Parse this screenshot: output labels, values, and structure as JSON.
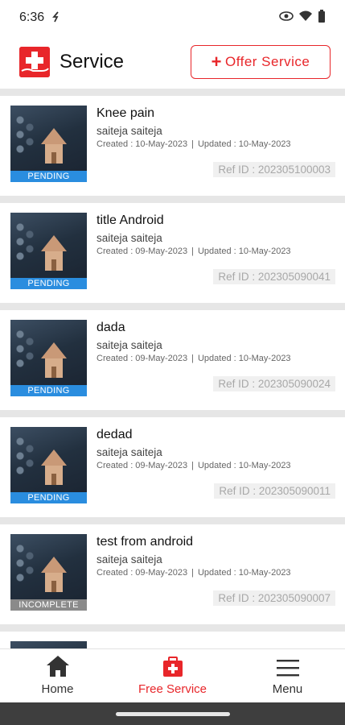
{
  "status_bar": {
    "time": "6:36"
  },
  "header": {
    "title": "Service",
    "offer_button": "Offer Service",
    "brand_color": "#e8262a"
  },
  "services": [
    {
      "title": "Knee pain",
      "user": "saiteja saiteja",
      "created": "Created : 10-May-2023",
      "updated": "Updated : 10-May-2023",
      "ref": "Ref ID : 202305100003",
      "status": "PENDING"
    },
    {
      "title": "title Android",
      "user": "saiteja saiteja",
      "created": "Created : 09-May-2023",
      "updated": "Updated : 10-May-2023",
      "ref": "Ref ID : 202305090041",
      "status": "PENDING"
    },
    {
      "title": "dada",
      "user": "saiteja saiteja",
      "created": "Created : 09-May-2023",
      "updated": "Updated : 10-May-2023",
      "ref": "Ref ID : 202305090024",
      "status": "PENDING"
    },
    {
      "title": "dedad",
      "user": "saiteja saiteja",
      "created": "Created : 09-May-2023",
      "updated": "Updated : 10-May-2023",
      "ref": "Ref ID : 202305090011",
      "status": "PENDING"
    },
    {
      "title": "test from android",
      "user": "saiteja saiteja",
      "created": "Created : 09-May-2023",
      "updated": "Updated : 10-May-2023",
      "ref": "Ref ID : 202305090007",
      "status": "INCOMPLETE"
    },
    {
      "title": "",
      "user": "",
      "created": "",
      "updated": "",
      "ref": "",
      "status": ""
    }
  ],
  "bottom_nav": {
    "home": "Home",
    "free_service": "Free Service",
    "menu": "Menu"
  },
  "colors": {
    "pending": "#2a8ddf",
    "incomplete": "#8a8a8a"
  }
}
